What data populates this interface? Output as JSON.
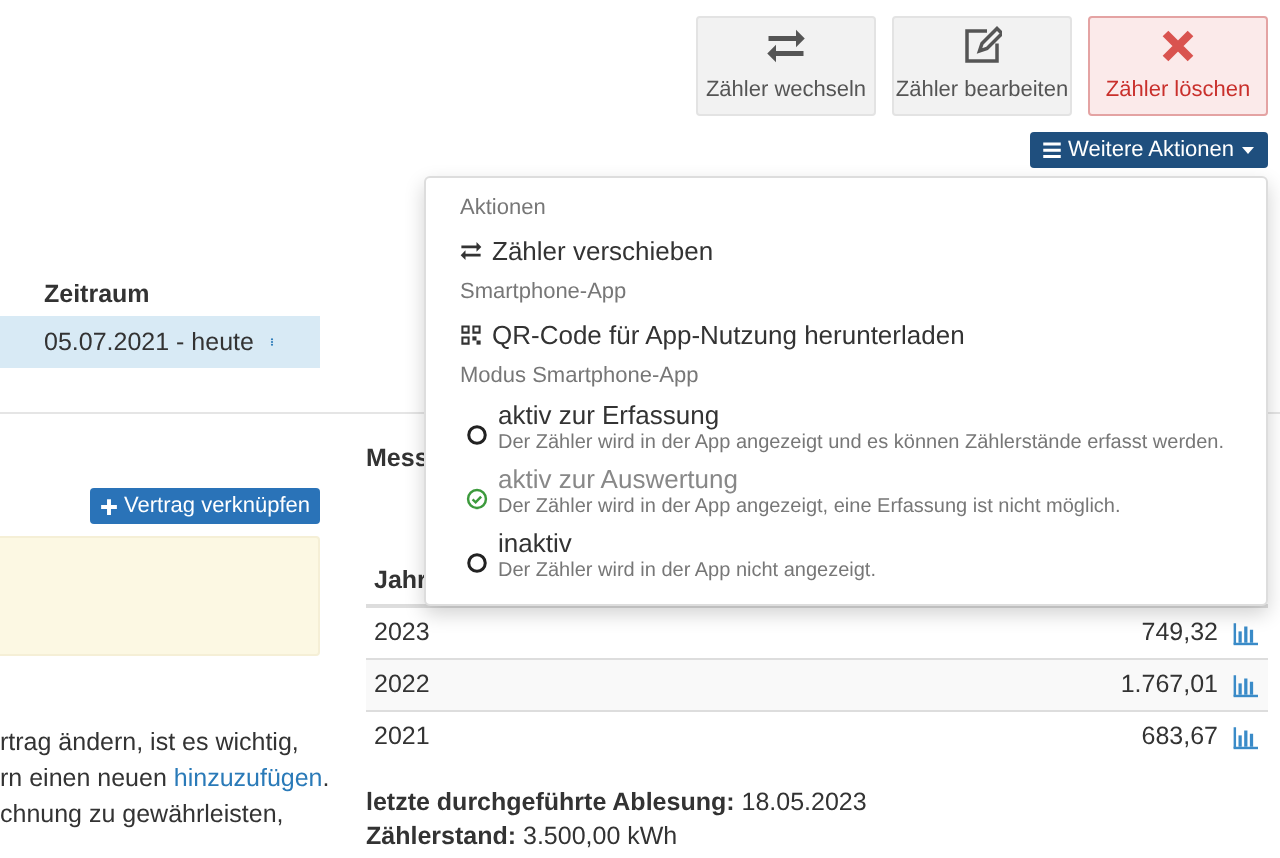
{
  "toolbar": {
    "buttons": [
      {
        "label": "Zähler wechseln",
        "kind": "swap",
        "danger": false
      },
      {
        "label": "Zähler bearbeiten",
        "kind": "edit",
        "danger": false
      },
      {
        "label": "Zähler löschen",
        "kind": "delete",
        "danger": true
      }
    ],
    "more_button": {
      "label": "Weitere Aktionen",
      "expanded": true
    }
  },
  "dropdown": {
    "items": [
      {
        "kind": "header",
        "label": "Aktionen"
      },
      {
        "kind": "move",
        "label": "Zähler verschieben"
      },
      {
        "kind": "header",
        "label": "Smartphone-App"
      },
      {
        "kind": "download",
        "label": "QR-Code für App-Nutzung herunterladen"
      },
      {
        "kind": "header",
        "label": "Modus Smartphone-App"
      },
      {
        "kind": "radio",
        "label": "aktiv zur Erfassung",
        "description": "Der Zähler wird in der App angezeigt und es können Zählerstände erfasst werden.",
        "selected": false
      },
      {
        "kind": "radio",
        "label": "aktiv zur Auswertung",
        "description": "Der Zähler wird in der App angezeigt, eine Erfassung ist nicht möglich.",
        "selected": true
      },
      {
        "kind": "radio",
        "label": "inaktiv",
        "description": "Der Zähler wird in der App nicht angezeigt.",
        "selected": false
      }
    ]
  },
  "contract_table": {
    "column": "Zeitraum",
    "rows": [
      {
        "period": "05.07.2021 - heute",
        "selected": true
      }
    ]
  },
  "link_button": "Vertrag verknüpfen",
  "notice_lines": [
    {
      "text": "rtrag ändern, ist es wichtig,"
    },
    {
      "text": "rn einen neuen ",
      "link": "hinzuzufügen",
      "after": "."
    },
    {
      "text": "chnung zu gewährleisten,"
    }
  ],
  "readings": {
    "heading": "Mess",
    "column": "Jahr",
    "rows": [
      {
        "year": "2023",
        "value": "749,32"
      },
      {
        "year": "2022",
        "value": "1.767,01"
      },
      {
        "year": "2021",
        "value": "683,67"
      }
    ]
  },
  "last_reading": {
    "label": "letzte durchgeführte Ablesung:",
    "value": "18.05.2023"
  },
  "meter_reading": {
    "label": "Zählerstand:",
    "value": "3.500,00 kWh"
  }
}
